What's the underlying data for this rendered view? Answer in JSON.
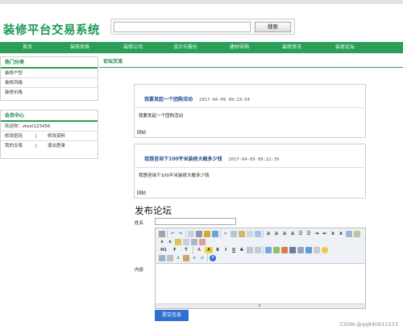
{
  "site": {
    "logo": "装修平台交易系统"
  },
  "search": {
    "placeholder": "",
    "button": "搜索"
  },
  "nav": {
    "items": [
      {
        "label": "首页"
      },
      {
        "label": "装修风格"
      },
      {
        "label": "装修公司"
      },
      {
        "label": "设计与报价"
      },
      {
        "label": "建材导购"
      },
      {
        "label": "装修资讯"
      },
      {
        "label": "装修论坛"
      }
    ]
  },
  "sidebar": {
    "categories": {
      "title": "热门分类",
      "items": [
        "装修户型",
        "装修风格",
        "装修价格"
      ]
    },
    "member": {
      "title": "会员中心",
      "welcome": "欢迎你：ztest123456",
      "links": [
        {
          "left": "修改密码",
          "sep": "|",
          "right": "修改资料"
        },
        {
          "left": "我的交易",
          "sep": "|",
          "right": "退出登录"
        }
      ]
    }
  },
  "main": {
    "section_title": "论坛交流",
    "posts": [
      {
        "title": "我要发起一个团购活动",
        "time": "2017-04-09 09:23:54",
        "body": "我要发起一个团购活动",
        "reply": "回帖"
      },
      {
        "title": "我想咨询下100平米装修大概多少钱",
        "time": "2017-04-09 09:22:39",
        "body": "我想咨询下100平米装修大概多少钱",
        "reply": "回帖"
      }
    ]
  },
  "form": {
    "title": "发布论坛",
    "name_label": "姓名",
    "content_label": "内容",
    "submit": "提交信息",
    "resize_glyph": "⇕"
  },
  "watermark": "CSDN @qq840612233",
  "colors": {
    "brand_green": "#2c9e58",
    "logo_green": "#1e9a55",
    "post_title_blue": "#1f4f8f",
    "submit_blue": "#2f6fd1"
  }
}
